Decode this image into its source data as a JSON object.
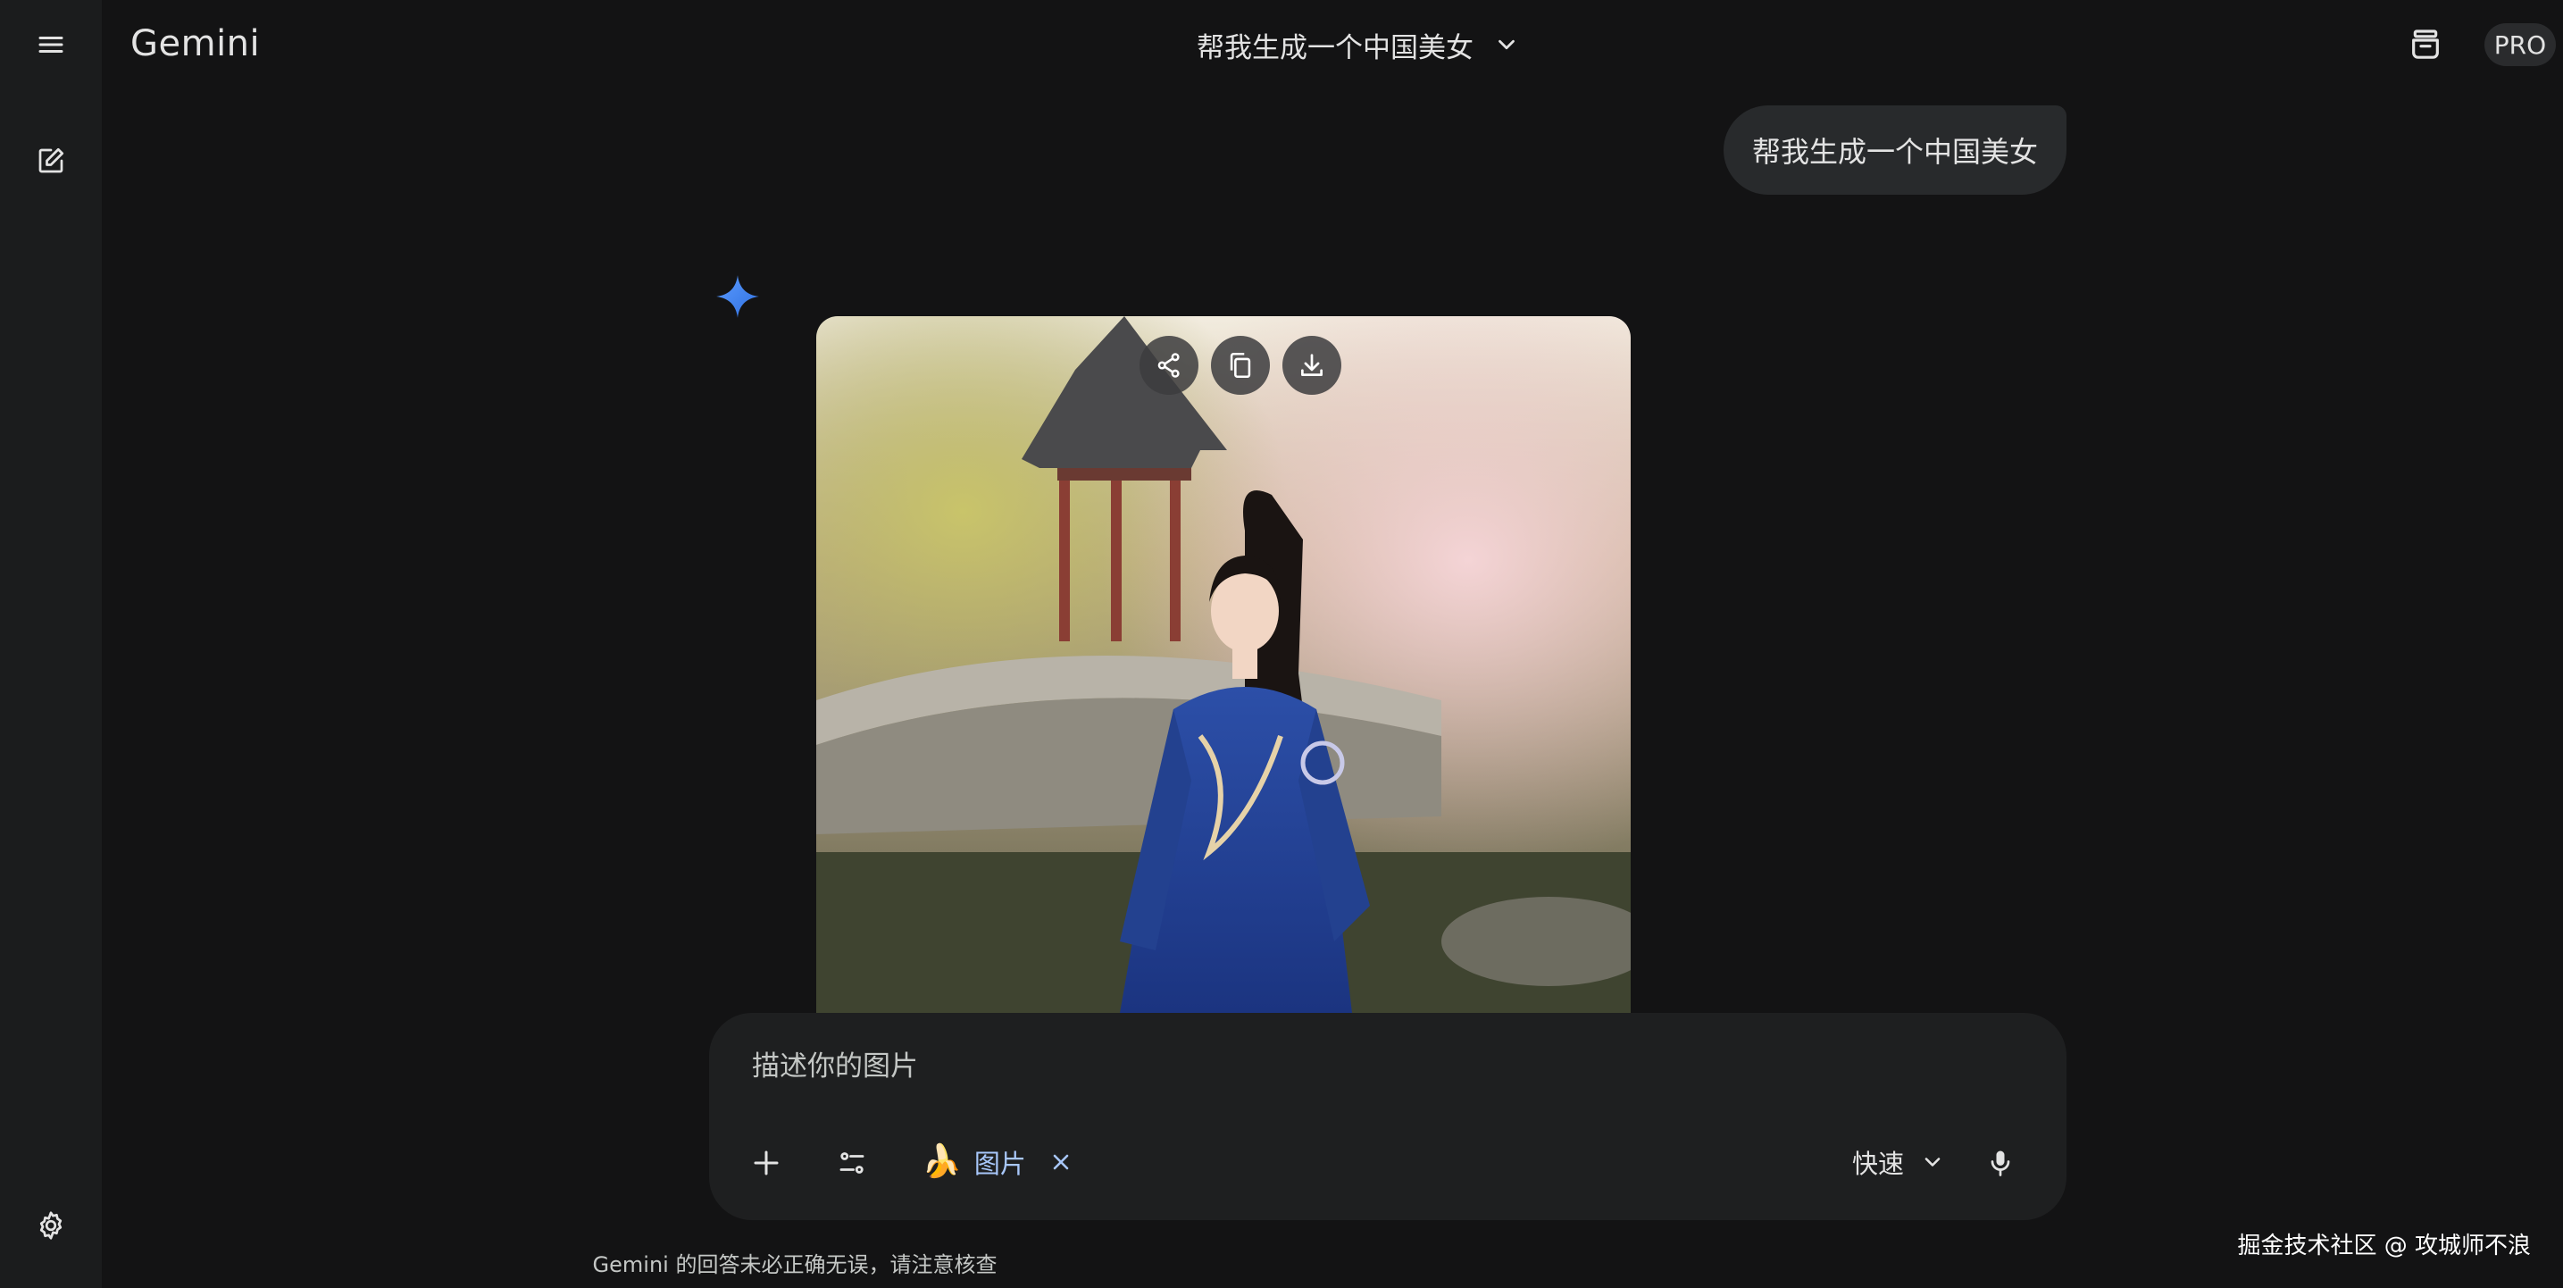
{
  "app": {
    "brand": "Gemini",
    "badge": "PRO"
  },
  "header": {
    "conversation_title": "帮我生成一个中国美女",
    "icons": {
      "menu": "menu-icon",
      "title_dropdown": "chevron-down-icon",
      "temporary_chat": "temporary-chat-icon"
    }
  },
  "sidebar": {
    "items": [
      {
        "name": "menu",
        "icon": "menu-icon"
      },
      {
        "name": "new-chat",
        "icon": "edit-icon"
      },
      {
        "name": "settings",
        "icon": "gear-icon"
      }
    ]
  },
  "conversation": {
    "user_message": "帮我生成一个中国美女",
    "response": {
      "avatar_icon": "gemini-spark-icon",
      "image_actions": [
        "share-icon",
        "copy-icon",
        "download-icon"
      ]
    }
  },
  "composer": {
    "placeholder": "描述你的图片",
    "tool_chip_label": "图片",
    "tool_chip_icon": "banana-emoji",
    "mode_label": "快速",
    "icons": {
      "add": "plus-icon",
      "tools": "tune-icon",
      "mic": "mic-icon",
      "close": "close-icon"
    }
  },
  "footer": {
    "disclaimer": "Gemini 的回答未必正确无误，请注意核查",
    "watermark": "掘金技术社区 @ 攻城师不浪"
  },
  "colors": {
    "background": "#131314",
    "sidebar": "#1b1c1d",
    "surface": "#1e1f20",
    "bubble": "#282a2c",
    "accent_blue": "#a8c7fa",
    "spark_blue": "#4a8cf7"
  }
}
